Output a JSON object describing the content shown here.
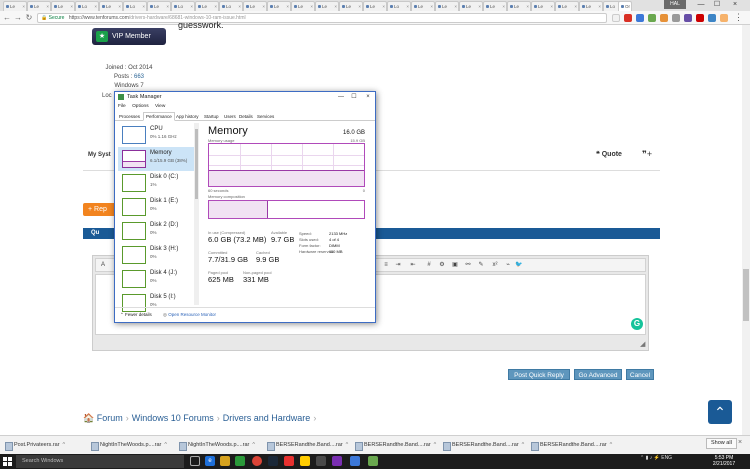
{
  "browser": {
    "tabs": [
      "Le",
      "Le",
      "Le",
      "Lo",
      "Le",
      "Lo",
      "Le",
      "Lo",
      "Le",
      "Lo",
      "Le",
      "Le",
      "Le",
      "Le",
      "Le",
      "Le",
      "Lo",
      "Le",
      "Le",
      "Le",
      "Le",
      "Le",
      "Le",
      "Le",
      "Le",
      "Lo"
    ],
    "close_glyph": "×",
    "last_tab": "Or",
    "user_badge": "HAL",
    "url_secure": "Secure",
    "url_host": "https://www.tenforums.com",
    "url_path": "/drivers-hardware/68681-windows-10-ram-issue.html",
    "minimize": "—",
    "restore": "☐",
    "close": "×",
    "back": "←",
    "forward": "→",
    "reload": "↻"
  },
  "post": {
    "vip_label": "VIP Member",
    "joined": "Joined : Oct 2014",
    "posts_label": "Posts : ",
    "posts_value": "663",
    "os": "Windows 7",
    "location_label": "Loc",
    "body_fragment": "guesswork.",
    "my_system": "My Syst",
    "quote": "Quote"
  },
  "reply_button": "+ Rep",
  "quick_reply_label": "Qu",
  "form_buttons": {
    "post_quick_reply": "Post Quick Reply",
    "go_advanced": "Go Advanced",
    "cancel": "Cancel"
  },
  "breadcrumb": [
    "Forum",
    "Windows 10 Forums",
    "Drivers and Hardware"
  ],
  "downloads": [
    "Post.Privateers.rar",
    "NightInTheWoods.p....rar",
    "NightInTheWoods.p....rar",
    "BERSERandthe.Band....rar",
    "BERSERandthe.Band....rar",
    "BERSERandthe.Band....rar",
    "BERSERandthe.Band....rar"
  ],
  "downloads_show_all": "Show all",
  "taskbar": {
    "search_placeholder": "Search Windows",
    "language": "ENG",
    "time": "5:53 PM",
    "date": "2/21/2017"
  },
  "task_manager": {
    "title": "Task Manager",
    "menu": [
      "File",
      "Options",
      "View"
    ],
    "tabs": [
      "Processes",
      "Performance",
      "App history",
      "Startup",
      "Users",
      "Details",
      "Services"
    ],
    "active_tab": "Performance",
    "sidebar": [
      {
        "name": "CPU",
        "value": "0% 1.16 GHz",
        "kind": "cpu"
      },
      {
        "name": "Memory",
        "value": "6.1/15.9 GB (38%)",
        "kind": "mem",
        "selected": true
      },
      {
        "name": "Disk 0 (C:)",
        "value": "1%",
        "kind": "disk"
      },
      {
        "name": "Disk 1 (E:)",
        "value": "0%",
        "kind": "disk"
      },
      {
        "name": "Disk 2 (D:)",
        "value": "0%",
        "kind": "disk"
      },
      {
        "name": "Disk 3 (H:)",
        "value": "0%",
        "kind": "disk"
      },
      {
        "name": "Disk 4 (J:)",
        "value": "0%",
        "kind": "disk"
      },
      {
        "name": "Disk 5 (I:)",
        "value": "0%",
        "kind": "disk"
      }
    ],
    "memory": {
      "title": "Memory",
      "total": "16.0 GB",
      "usage_label": "Memory usage",
      "usage_max": "15.9 GB",
      "usage_fraction": 0.38,
      "seconds_label": "60 seconds",
      "zero_label": "0",
      "composition_label": "Memory composition",
      "composition_used_fraction": 0.38,
      "in_use_label": "In use (Compressed)",
      "in_use_value": "6.0 GB (73.2 MB)",
      "available_label": "Available",
      "available_value": "9.7 GB",
      "committed_label": "Committed",
      "committed_value": "7.7/31.9 GB",
      "cached_label": "Cached",
      "cached_value": "9.9 GB",
      "paged_label": "Paged pool",
      "paged_value": "625 MB",
      "nonpaged_label": "Non-paged pool",
      "nonpaged_value": "331 MB",
      "speed_label": "Speed:",
      "speed_value": "2133 MHz",
      "slots_label": "Slots used:",
      "slots_value": "4 of 4",
      "form_label": "Form factor:",
      "form_value": "DIMM",
      "reserved_label": "Hardware reserved:",
      "reserved_value": "110 MB"
    },
    "fewer_details": "Fewer details",
    "open_resource_monitor": "Open Resource Monitor"
  },
  "colors": {
    "forum_blue": "#1a5a96",
    "orange": "#f2841f",
    "memory_purple": "#9a3aa6",
    "disk_green": "#5a9a2c",
    "cpu_blue": "#4a7fbf"
  }
}
